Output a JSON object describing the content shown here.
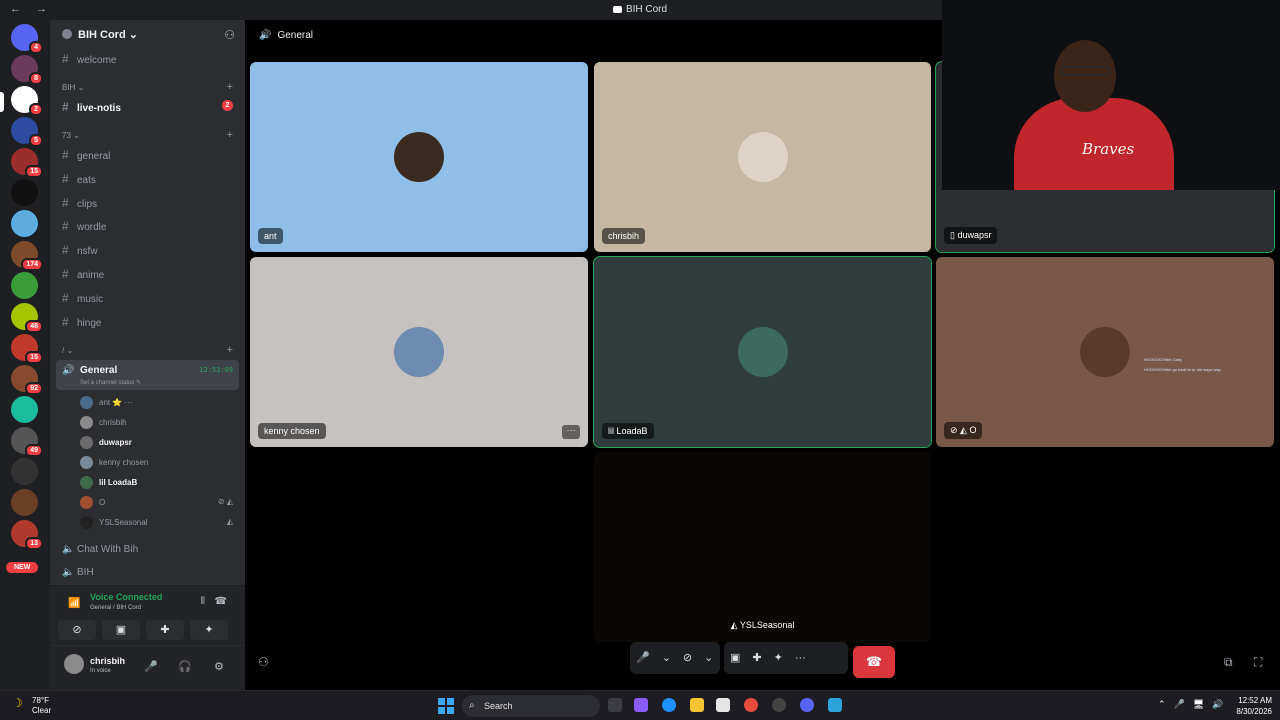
{
  "window": {
    "title": "BIH Cord",
    "nav": "← →"
  },
  "servers": {
    "items": [
      {
        "name": "discord-home-icon",
        "color": "#5865f2",
        "badge": "4"
      },
      {
        "name": "server-1",
        "color": "#6a3b5a",
        "badge": "8"
      },
      {
        "name": "server-bih",
        "color": "#ffffff",
        "badge": "2"
      },
      {
        "name": "server-3",
        "color": "#2d4ba0",
        "badge": "5"
      },
      {
        "name": "server-4",
        "color": "#9b2d2d",
        "badge": "15"
      },
      {
        "name": "server-5",
        "color": "#111111",
        "badge": ""
      },
      {
        "name": "server-6",
        "color": "#5dade2",
        "badge": ""
      },
      {
        "name": "server-7",
        "color": "#7d4b2a",
        "badge": "174"
      },
      {
        "name": "server-8",
        "color": "#3a9d3a",
        "badge": ""
      },
      {
        "name": "server-9",
        "color": "#a4c400",
        "badge": "48"
      },
      {
        "name": "server-10",
        "color": "#c0392b",
        "badge": "15"
      },
      {
        "name": "server-11",
        "color": "#884a2f",
        "badge": "92"
      },
      {
        "name": "server-12",
        "color": "#1abc9c",
        "badge": ""
      },
      {
        "name": "server-13",
        "color": "#555555",
        "badge": "49"
      },
      {
        "name": "server-14",
        "color": "#333333",
        "badge": ""
      },
      {
        "name": "server-15",
        "color": "#6b3e26",
        "badge": ""
      },
      {
        "name": "server-16",
        "color": "#b03a2e",
        "badge": "13"
      }
    ],
    "new_label": "NEW"
  },
  "guild": {
    "name": "BIH Cord"
  },
  "channels": {
    "welcome": "welcome",
    "cat1": "BIH",
    "live_notis": "live-notis",
    "live_notis_mentions": "2",
    "cat2": "73",
    "list": [
      "general",
      "eats",
      "clips",
      "wordle",
      "nsfw",
      "anime",
      "music",
      "hinge"
    ],
    "cat3": "/"
  },
  "voice_channel": {
    "name": "General",
    "timer": "12:53:09",
    "status": "Set a channel status",
    "users": [
      {
        "name": "ant",
        "color": "#4a6b8a",
        "extra": "⭐ ···",
        "bright": false
      },
      {
        "name": "chrisbih",
        "color": "#8b8b8b",
        "extra": "",
        "bright": false
      },
      {
        "name": "duwapsr",
        "color": "#6b6b6b",
        "extra": "",
        "bright": true
      },
      {
        "name": "kenny chosen",
        "color": "#7a8a9a",
        "extra": "",
        "bright": false
      },
      {
        "name": "lil LoadaB",
        "color": "#3f6b4a",
        "extra": "",
        "bright": true
      },
      {
        "name": "O",
        "color": "#a05030",
        "extra": "",
        "bright": false
      },
      {
        "name": "YSLSeasonal",
        "color": "#222222",
        "extra": "",
        "bright": false
      }
    ]
  },
  "other_voice": [
    "Chat With Bih",
    "BIH"
  ],
  "voice_status": {
    "title": "Voice Connected",
    "sub": "General / BIH Cord"
  },
  "user": {
    "name": "chrisbih",
    "status": "In voice"
  },
  "stage": {
    "channel": "General",
    "tiles": [
      {
        "label": "ant",
        "bg": "#8fbfe8",
        "avatar": "#3a2a20"
      },
      {
        "label": "chrisbih",
        "bg": "#c4b8a3",
        "avatar": "#ddd4c6"
      },
      {
        "label": "duwapsr",
        "bg": "#2b2d31",
        "avatar": ""
      },
      {
        "label": "kenny chosen",
        "bg": "#c5c2bf",
        "avatar": "#6e8bb0"
      },
      {
        "label": "lil LoadaB",
        "bg": "#2f3d3d",
        "avatar": "#3c6a5c"
      },
      {
        "label": "O",
        "bg": "#7a5848",
        "avatar": "#5a3a2a"
      },
      {
        "label": "YSLSeasonal",
        "bg": "#0a0704",
        "avatar": ""
      }
    ],
    "caption_line1": "HOOOOO:fhbh Gaby",
    "caption_line2": "HOOOOO:fhbh go back to ur old ways wap",
    "webcam_logo": "Braves"
  },
  "taskbar": {
    "temp": "78°F",
    "condition": "Clear",
    "search_placeholder": "Search",
    "time": "12:52 AM",
    "date": "8/30/2026"
  }
}
